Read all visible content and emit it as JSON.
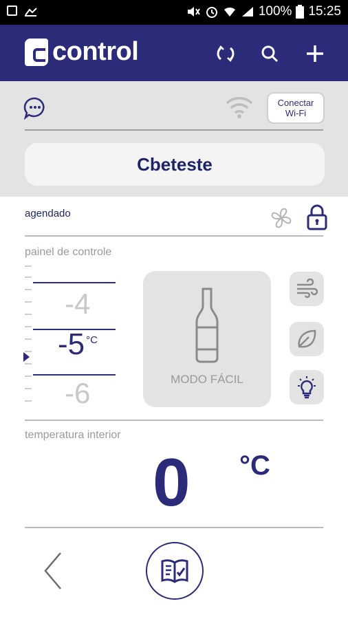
{
  "status_bar": {
    "battery_percent": "100%",
    "time": "15:25"
  },
  "header": {
    "logo_text": "control",
    "icons": [
      "sync-icon",
      "search-icon",
      "add-icon"
    ]
  },
  "connection": {
    "chat_icon": "chat-icon",
    "wifi_icon": "wifi-icon",
    "wifi_button_label_line1": "Conectar",
    "wifi_button_label_line2": "Wi-Fi"
  },
  "device": {
    "name": "Cbeteste"
  },
  "schedule": {
    "label": "agendado",
    "icons": [
      "fan-icon",
      "lock-icon"
    ]
  },
  "control_panel": {
    "label": "painel de controle",
    "scale_above": "-4",
    "scale_selected": "-5",
    "scale_unit": "°C",
    "scale_below": "-6",
    "mode_label": "MODO FÁCIL",
    "side_buttons": [
      "wind-icon",
      "leaf-icon",
      "light-bulb-icon"
    ]
  },
  "interior": {
    "label": "temperatura interior",
    "value": "0",
    "unit": "°C"
  },
  "footer": {
    "icons": [
      "back-icon",
      "manual-book-icon"
    ]
  },
  "colors": {
    "brand": "#2b2b7a",
    "panel_grey": "#e3e3e3"
  }
}
